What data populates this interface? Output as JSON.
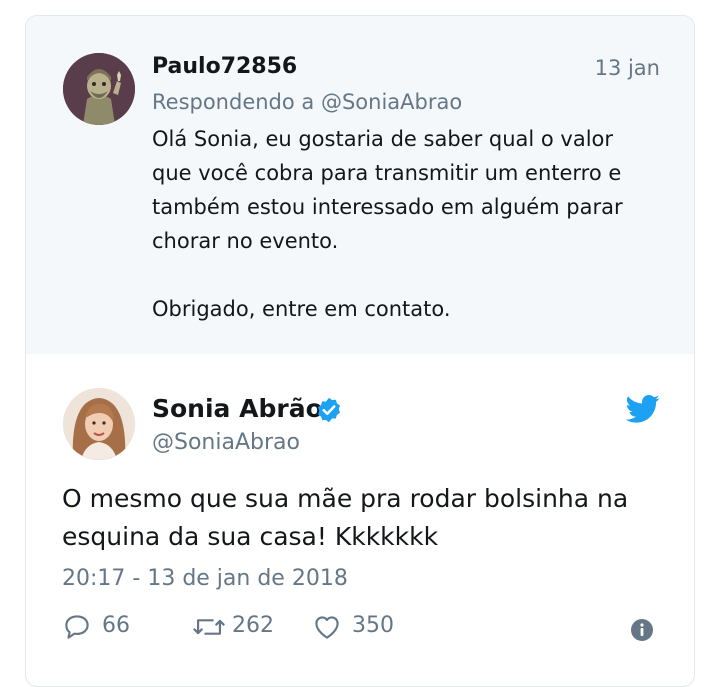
{
  "reply_tweet": {
    "author": "Paulo72856",
    "date": "13 jan",
    "replying_to": "Respondendo a @SoniaAbrao",
    "text_lines": [
      "Olá Sonia, eu gostaria de saber qual o valor",
      "que você cobra para transmitir um enterro e",
      "também estou interessado em alguém parar",
      "chorar no evento.",
      "",
      "Obrigado, entre em contato."
    ]
  },
  "main_tweet": {
    "name": "Sonia Abrão",
    "handle": "@SoniaAbrao",
    "text_lines": [
      "O mesmo que sua mãe pra rodar bolsinha na",
      "esquina da sua casa! Kkkkkkk"
    ],
    "timestamp": "20:17 - 13 de jan de 2018",
    "replies": "66",
    "retweets": "262",
    "likes": "350"
  },
  "colors": {
    "twitter_blue": "#1da1f2",
    "secondary_text": "#657786",
    "reply_background": "#f5f8fa"
  },
  "icons": [
    "verified-icon",
    "twitter-bird-icon",
    "reply-icon",
    "retweet-icon",
    "like-icon",
    "info-icon"
  ]
}
